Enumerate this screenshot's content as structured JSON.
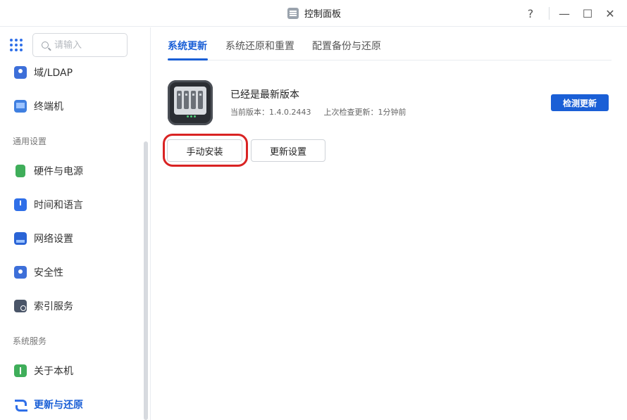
{
  "window": {
    "title": "控制面板",
    "help": "?",
    "minimize": "—",
    "maximize": "☐",
    "close": "✕"
  },
  "sidebar": {
    "search_placeholder": "请输入",
    "items_top": [
      {
        "label": "域/LDAP",
        "icon": "domain-icon"
      },
      {
        "label": "终端机",
        "icon": "terminal-icon"
      }
    ],
    "section_general": "通用设置",
    "items_general": [
      {
        "label": "硬件与电源",
        "icon": "hardware-icon"
      },
      {
        "label": "时间和语言",
        "icon": "clock-icon"
      },
      {
        "label": "网络设置",
        "icon": "network-icon"
      },
      {
        "label": "安全性",
        "icon": "shield-icon"
      },
      {
        "label": "索引服务",
        "icon": "index-icon"
      }
    ],
    "section_system": "系统服务",
    "items_system": [
      {
        "label": "关于本机",
        "icon": "info-icon"
      },
      {
        "label": "更新与还原",
        "icon": "update-icon",
        "active": true
      }
    ]
  },
  "tabs": [
    {
      "label": "系统更新",
      "active": true
    },
    {
      "label": "系统还原和重置"
    },
    {
      "label": "配置备份与还原"
    }
  ],
  "update": {
    "status": "已经是最新版本",
    "current_version": "当前版本：1.4.0.2443",
    "last_check": "上次检查更新：1分钟前",
    "check_button": "检测更新",
    "manual_install_button": "手动安装",
    "update_settings_button": "更新设置"
  },
  "colors": {
    "accent": "#1a5fd6",
    "highlight": "#d92323"
  }
}
